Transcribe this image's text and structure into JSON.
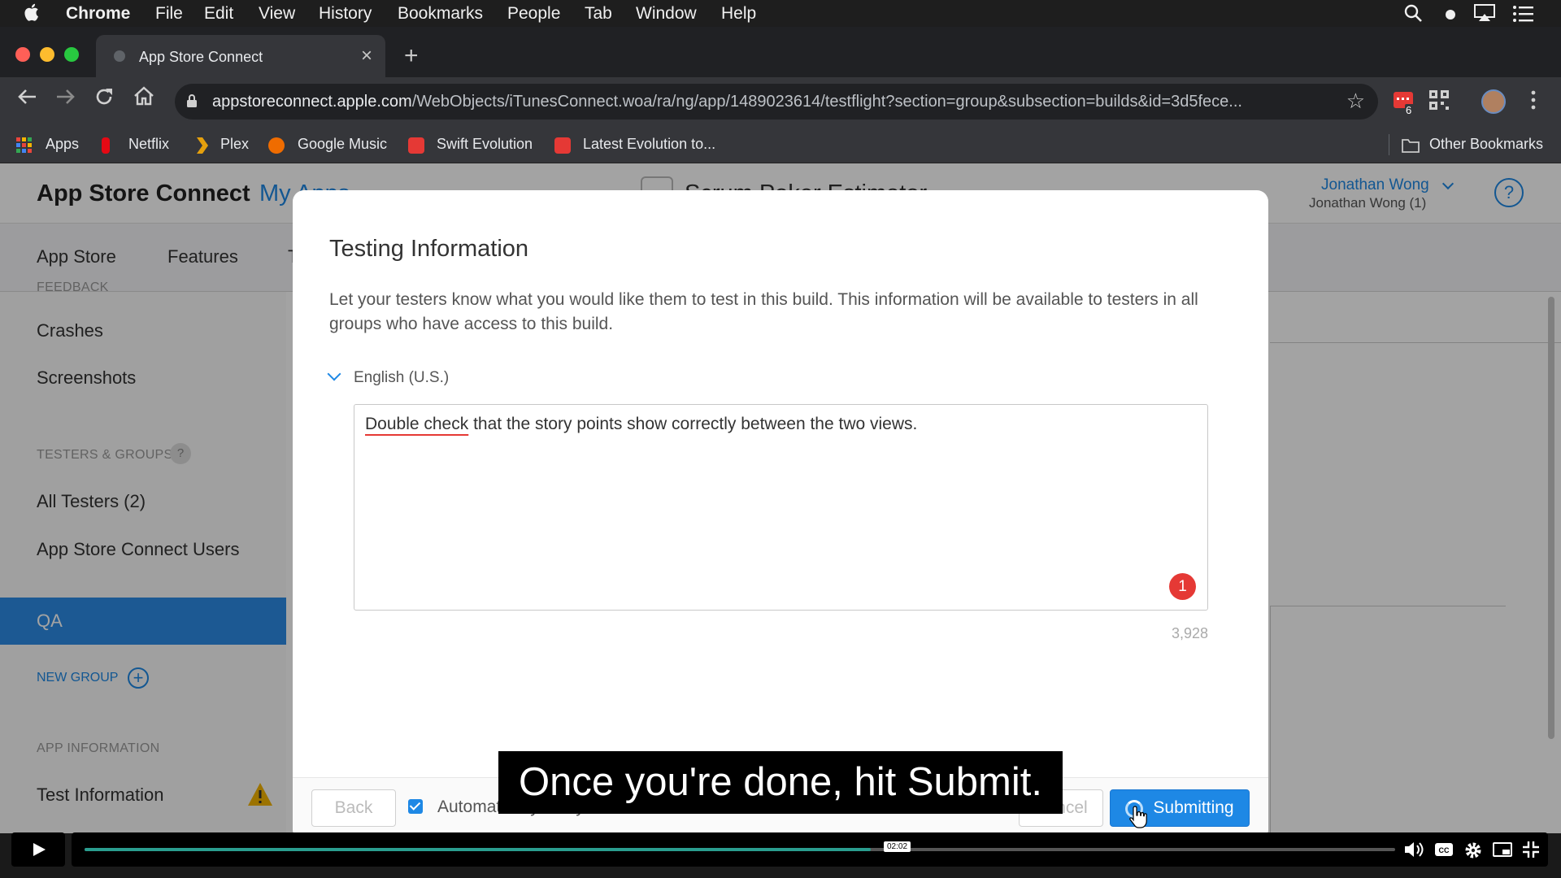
{
  "menubar": {
    "app": "Chrome",
    "items": [
      "File",
      "Edit",
      "View",
      "History",
      "Bookmarks",
      "People",
      "Tab",
      "Window",
      "Help"
    ]
  },
  "tab": {
    "title": "App Store Connect"
  },
  "address": {
    "host": "appstoreconnect.apple.com",
    "path": "/WebObjects/iTunesConnect.woa/ra/ng/app/1489023614/testflight?section=group&subsection=builds&id=3d5fece..."
  },
  "extension_badge": "6",
  "bookmarks": {
    "items": [
      "Apps",
      "Netflix",
      "Plex",
      "Google Music",
      "Swift Evolution",
      "Latest Evolution to..."
    ],
    "other": "Other Bookmarks"
  },
  "asc": {
    "brand": "App Store Connect",
    "my_apps": "My Apps",
    "app_name": "Scrum Poker Estimator",
    "user_name": "Jonathan Wong",
    "team": "Jonathan Wong (1)",
    "help": "?",
    "tabs": [
      "App Store",
      "Features",
      "T"
    ]
  },
  "sidebar": {
    "feedback_head": "FEEDBACK",
    "crashes": "Crashes",
    "screenshots": "Screenshots",
    "testers_head": "TESTERS & GROUPS",
    "testers_help": "?",
    "all_testers": "All Testers (2)",
    "asc_users": "App Store Connect Users",
    "qa": "QA",
    "new_group": "NEW GROUP",
    "appinfo_head": "APP INFORMATION",
    "test_info": "Test Information"
  },
  "modal": {
    "title": "Testing Information",
    "description": "Let your testers know what you would like them to test in this build. This information will be available to testers in all groups who have access to this build.",
    "language": "English (U.S.)",
    "text_misspelled": "Double check",
    "text_rest": " that the story points show correctly between the two views.",
    "badge": "1",
    "char_count": "3,928",
    "back": "Back",
    "notify": "Automatically notify testers",
    "cancel": "Cancel",
    "submit": "Submitting"
  },
  "caption": "Once you're done, hit Submit.",
  "player": {
    "time": "02:02",
    "progress": 0.6
  },
  "colors": {
    "accent": "#1e88e5",
    "sidebar_selected": "#2d8ce6",
    "warning": "#f5b400",
    "error": "#e53935"
  }
}
